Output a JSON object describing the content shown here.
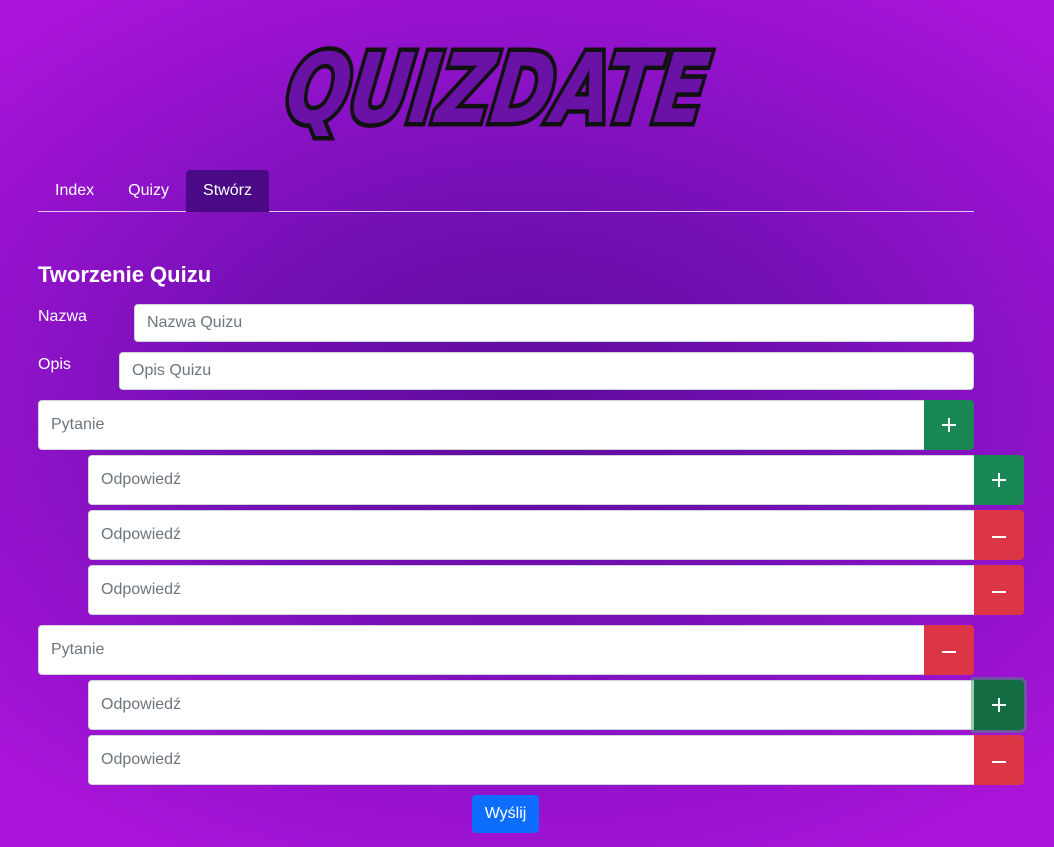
{
  "logo": {
    "text": "QUIZDATE"
  },
  "nav": {
    "tabs": [
      {
        "label": "Index"
      },
      {
        "label": "Quizy"
      },
      {
        "label": "Stwórz"
      }
    ],
    "active": "Stwórz"
  },
  "form": {
    "title": "Tworzenie Quizu",
    "name_label": "Nazwa",
    "name_placeholder": "Nazwa Quizu",
    "description_label": "Opis",
    "description_placeholder": "Opis Quizu",
    "questions": [
      {
        "placeholder": "Pytanie",
        "button": "add",
        "answers": [
          {
            "placeholder": "Odpowiedź",
            "button": "add"
          },
          {
            "placeholder": "Odpowiedź",
            "button": "remove"
          },
          {
            "placeholder": "Odpowiedź",
            "button": "remove"
          }
        ]
      },
      {
        "placeholder": "Pytanie",
        "button": "remove",
        "answers": [
          {
            "placeholder": "Odpowiedź",
            "button": "add"
          },
          {
            "placeholder": "Odpowiedź",
            "button": "remove"
          }
        ]
      }
    ],
    "submit_label": "Wyślij"
  },
  "colors": {
    "add": "#198754",
    "remove": "#dc3545",
    "submit": "#0d6efd",
    "active_tab": "#4a0a86"
  }
}
